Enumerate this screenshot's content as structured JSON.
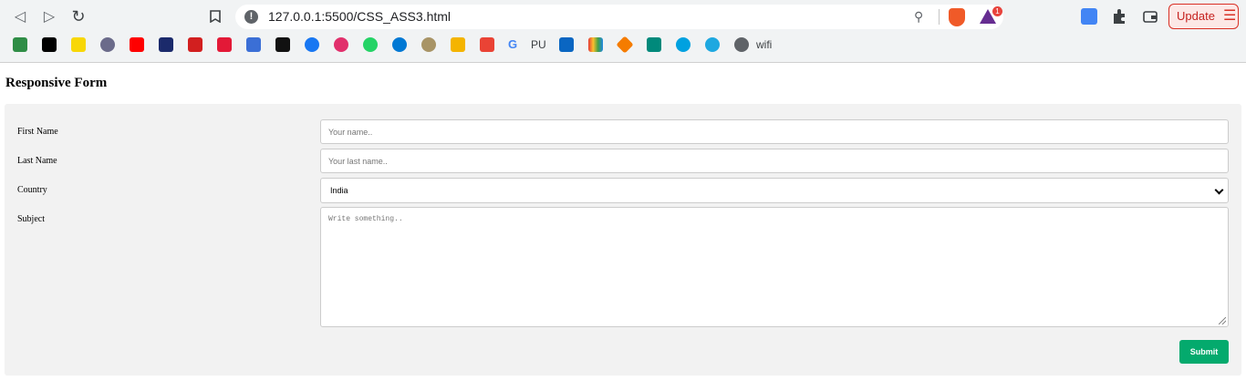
{
  "browser": {
    "url": "127.0.0.1:5500/CSS_ASS3.html",
    "update_label": "Update",
    "bookmarks": [
      {
        "icon": "gfg-icon",
        "color": "#2f8d46"
      },
      {
        "icon": "amazon-icon",
        "color": "#000000"
      },
      {
        "icon": "flipkart-icon",
        "color": "#f8d706"
      },
      {
        "icon": "circle-icon",
        "color": "#6b6b8a"
      },
      {
        "icon": "youtube-icon",
        "color": "#ff0000"
      },
      {
        "icon": "dh-icon",
        "color": "#1b2a6b"
      },
      {
        "icon": "toi-icon",
        "color": "#d21f1f"
      },
      {
        "icon": "tesla-icon",
        "color": "#e31937"
      },
      {
        "icon": "bird-icon",
        "color": "#3b6fd6"
      },
      {
        "icon": "medium-icon",
        "color": "#111111"
      },
      {
        "icon": "facebook-icon",
        "color": "#1877f2"
      },
      {
        "icon": "instagram-icon",
        "color": "#e1306c"
      },
      {
        "icon": "whatsapp-icon",
        "color": "#25d366"
      },
      {
        "icon": "skype-icon",
        "color": "#0078d4"
      },
      {
        "icon": "emblem-icon",
        "color": "#a89466"
      },
      {
        "icon": "classroom-icon",
        "color": "#f4b400"
      },
      {
        "icon": "gmail-icon",
        "color": "#ea4335"
      }
    ],
    "bookmark_pu": "PU",
    "bookmark_wifi": "wifi"
  },
  "page": {
    "title": "Responsive Form"
  },
  "form": {
    "first_name_label": "First Name",
    "first_name_placeholder": "Your name..",
    "last_name_label": "Last Name",
    "last_name_placeholder": "Your last name..",
    "country_label": "Country",
    "country_value": "India",
    "subject_label": "Subject",
    "subject_placeholder": "Write something..",
    "submit_label": "Submit"
  },
  "colors": {
    "submit": "#04aa6d",
    "form_bg": "#f2f2f2"
  }
}
